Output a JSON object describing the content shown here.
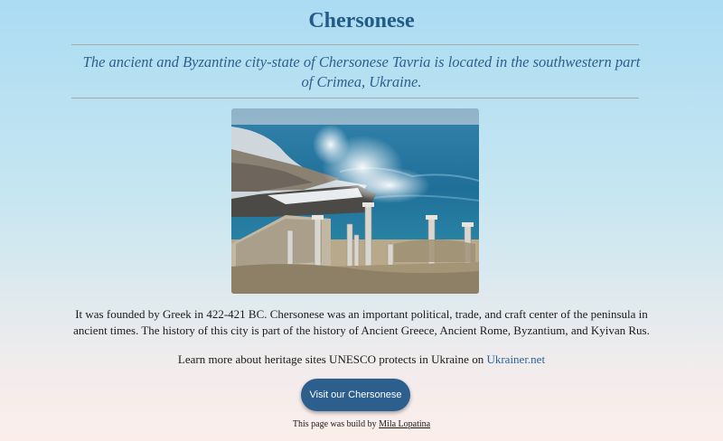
{
  "page": {
    "title": "Chersonese",
    "lead": "The ancient and Byzantine city-state of Chersonese Tavria is located in the southwestern part of Crimea, Ukraine.",
    "body": "It was founded by Greek in 422-421 BC. Chersonese was an important political, trade, and craft center of the peninsula in ancient times. The history of this city is part of the history of Ancient Greece, Ancient Rome, Byzantium, and Kyivan Rus.",
    "learn_prefix": "Learn more about heritage sites UNESCO protects in Ukraine on",
    "learn_link": "Ukrainer.net",
    "button_label": "Visit our Chersonese",
    "credit_prefix": "This page was build by",
    "credit_link": "Mila Lopatina"
  },
  "colors": {
    "title": "#245a87",
    "lead": "#2d5f8d",
    "link": "#2b6396",
    "button_bg": "#2c5f8e"
  }
}
